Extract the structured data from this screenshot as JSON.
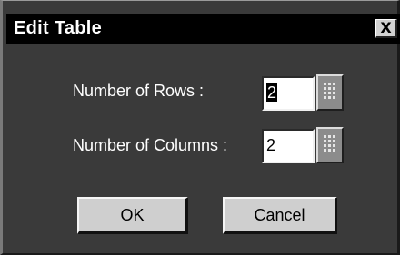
{
  "window": {
    "title": "Edit Table",
    "close_label": "X"
  },
  "form": {
    "rows_label": "Number of Rows :",
    "rows_value": "2",
    "columns_label": "Number of Columns :",
    "columns_value": "2"
  },
  "buttons": {
    "ok_label": "OK",
    "cancel_label": "Cancel"
  },
  "icons": {
    "close": "close-icon",
    "grid_picker": "grid-icon"
  }
}
